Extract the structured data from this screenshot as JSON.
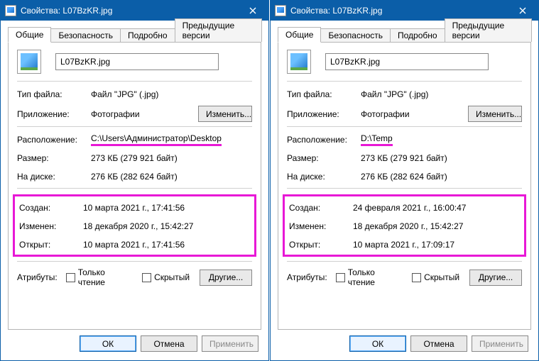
{
  "windows": [
    {
      "title": "Свойства: L07BzKR.jpg",
      "tabs": [
        "Общие",
        "Безопасность",
        "Подробно",
        "Предыдущие версии"
      ],
      "filename": "L07BzKR.jpg",
      "filetype_label": "Тип файла:",
      "filetype_value": "Файл \"JPG\" (.jpg)",
      "app_label": "Приложение:",
      "app_value": "Фотографии",
      "change_label": "Изменить...",
      "location_label": "Расположение:",
      "location_value": "C:\\Users\\Администратор\\Desktop",
      "size_label": "Размер:",
      "size_value": "273 КБ (279 921 байт)",
      "disk_label": "На диске:",
      "disk_value": "276 КБ (282 624 байт)",
      "created_label": "Создан:",
      "created_value": "10 марта 2021 г., 17:41:56",
      "modified_label": "Изменен:",
      "modified_value": "18 декабря 2020 г., 15:42:27",
      "accessed_label": "Открыт:",
      "accessed_value": "10 марта 2021 г., 17:41:56",
      "attrib_label": "Атрибуты:",
      "readonly_label": "Только чтение",
      "hidden_label": "Скрытый",
      "other_label": "Другие...",
      "ok_label": "ОК",
      "cancel_label": "Отмена",
      "apply_label": "Применить"
    },
    {
      "title": "Свойства: L07BzKR.jpg",
      "tabs": [
        "Общие",
        "Безопасность",
        "Подробно",
        "Предыдущие версии"
      ],
      "filename": "L07BzKR.jpg",
      "filetype_label": "Тип файла:",
      "filetype_value": "Файл \"JPG\" (.jpg)",
      "app_label": "Приложение:",
      "app_value": "Фотографии",
      "change_label": "Изменить...",
      "location_label": "Расположение:",
      "location_value": "D:\\Temp",
      "size_label": "Размер:",
      "size_value": "273 КБ (279 921 байт)",
      "disk_label": "На диске:",
      "disk_value": "276 КБ (282 624 байт)",
      "created_label": "Создан:",
      "created_value": "24 февраля 2021 г., 16:00:47",
      "modified_label": "Изменен:",
      "modified_value": "18 декабря 2020 г., 15:42:27",
      "accessed_label": "Открыт:",
      "accessed_value": "10 марта 2021 г., 17:09:17",
      "attrib_label": "Атрибуты:",
      "readonly_label": "Только чтение",
      "hidden_label": "Скрытый",
      "other_label": "Другие...",
      "ok_label": "ОК",
      "cancel_label": "Отмена",
      "apply_label": "Применить"
    }
  ]
}
